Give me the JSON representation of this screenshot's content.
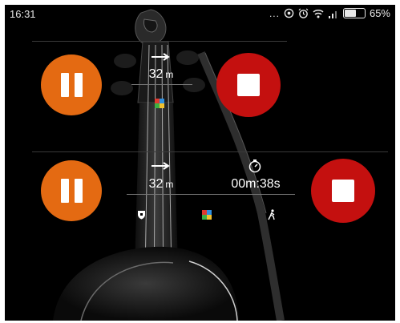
{
  "status_bar": {
    "time": "16:31",
    "overflow_dots": "...",
    "battery_text": "65%",
    "battery_level": 0.65
  },
  "panel_top": {
    "distance_value": "32",
    "distance_unit": "m"
  },
  "panel_bottom": {
    "distance_value": "32",
    "distance_unit": "m",
    "elapsed_time": "00m:38s"
  },
  "colors": {
    "pause": "#e46a12",
    "stop": "#c4100f"
  },
  "icons": [
    "eye-icon",
    "alarm-icon",
    "wifi-icon",
    "signal-icon",
    "battery-icon",
    "direction-arrow-icon",
    "color-grid-icon",
    "stopwatch-icon",
    "shield-icon",
    "walker-icon"
  ]
}
